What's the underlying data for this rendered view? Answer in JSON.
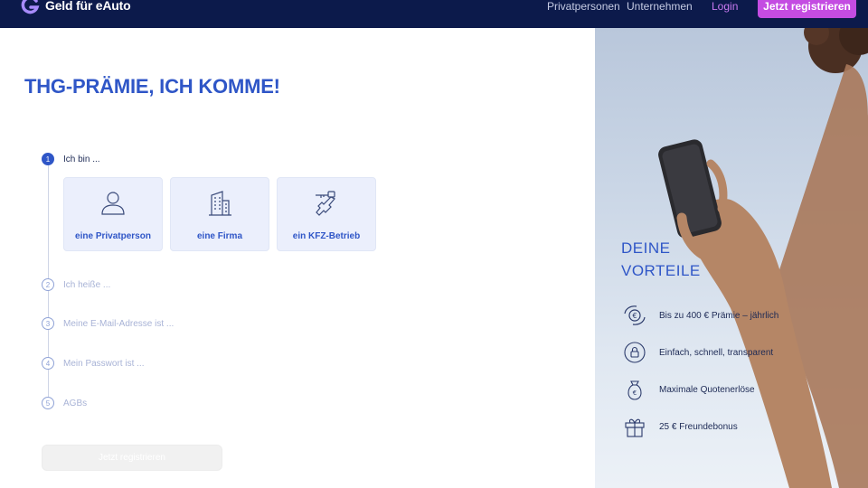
{
  "header": {
    "brand": "Geld für eAuto",
    "nav": [
      "Privatpersonen",
      "Unternehmen"
    ],
    "login_label": "Login",
    "register_label": "Jetzt registrieren"
  },
  "main": {
    "headline": "THG-PRÄMIE, ICH KOMME!",
    "steps": [
      {
        "number": "1",
        "label": "Ich bin ...",
        "active": true
      },
      {
        "number": "2",
        "label": "Ich heiße ..."
      },
      {
        "number": "3",
        "label": "Meine E-Mail-Adresse ist ..."
      },
      {
        "number": "4",
        "label": "Mein Passwort ist ..."
      },
      {
        "number": "5",
        "label": "AGBs"
      }
    ],
    "options": [
      {
        "label": "eine Privatperson",
        "icon": "person-icon"
      },
      {
        "label": "eine Firma",
        "icon": "building-icon"
      },
      {
        "label": "ein KFZ-Betrieb",
        "icon": "car-keys-icon"
      }
    ],
    "submit_label": "Jetzt registrieren"
  },
  "benefits": {
    "title_line1": "DEINE",
    "title_line2": "VORTEILE",
    "items": [
      {
        "text": "Bis zu 400 € Prämie – jährlich",
        "icon": "euro-cycle-icon"
      },
      {
        "text": "Einfach, schnell, transparent",
        "icon": "lock-cycle-icon"
      },
      {
        "text": "Maximale Quotenerlöse",
        "icon": "money-bag-icon"
      },
      {
        "text": "25 € Freundebonus",
        "icon": "gift-icon"
      }
    ]
  },
  "colors": {
    "navy": "#0c1a4b",
    "primary_blue": "#2f56c7",
    "accent_purple": "#c44ce2"
  }
}
